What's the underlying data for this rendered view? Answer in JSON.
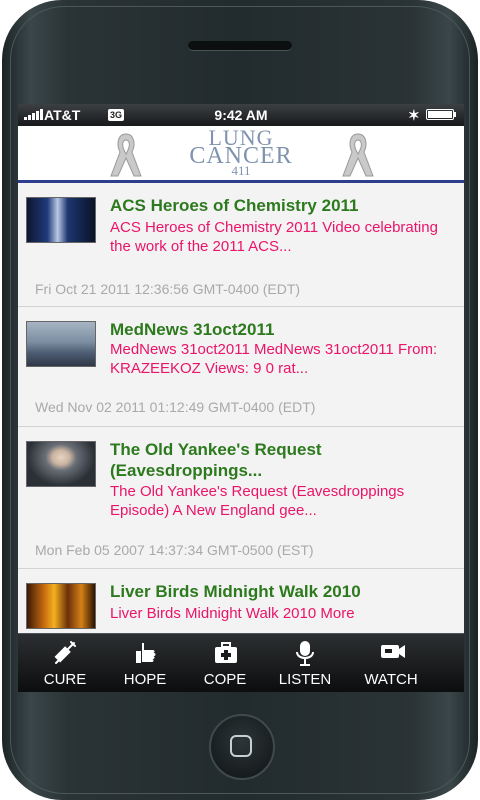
{
  "status_bar": {
    "carrier": "AT&T",
    "network": "3G",
    "time": "9:42 AM"
  },
  "header": {
    "logo_line1": "LUNG",
    "logo_line2": "CANCER",
    "logo_line3": "411"
  },
  "items": [
    {
      "title": "ACS Heroes of Chemistry 2011",
      "description": "ACS Heroes of Chemistry 2011 Video celebrating the work of the 2011 ACS...",
      "date": "Fri Oct 21 2011 12:36:56 GMT-0400 (EDT)"
    },
    {
      "title": "MedNews 31oct2011",
      "description": "MedNews 31oct2011 MedNews 31oct2011 From: KRAZEEKOZ Views: 9 0 rat...",
      "date": "Wed Nov 02 2011 01:12:49 GMT-0400 (EDT)"
    },
    {
      "title": "The Old Yankee's Request (Eavesdroppings...",
      "description": "The Old Yankee's Request (Eavesdroppings Episode) A New England gee...",
      "date": "Mon Feb 05 2007 14:37:34 GMT-0500 (EST)"
    },
    {
      "title": "Liver Birds Midnight Walk 2010",
      "description": "Liver Birds Midnight Walk 2010 More",
      "date": ""
    }
  ],
  "tabs": [
    {
      "label": "CURE",
      "icon": "syringe-icon"
    },
    {
      "label": "HOPE",
      "icon": "thumbs-up-icon"
    },
    {
      "label": "COPE",
      "icon": "first-aid-kit-icon"
    },
    {
      "label": "LISTEN",
      "icon": "microphone-icon"
    },
    {
      "label": "WATCH",
      "icon": "video-camera-icon"
    }
  ]
}
